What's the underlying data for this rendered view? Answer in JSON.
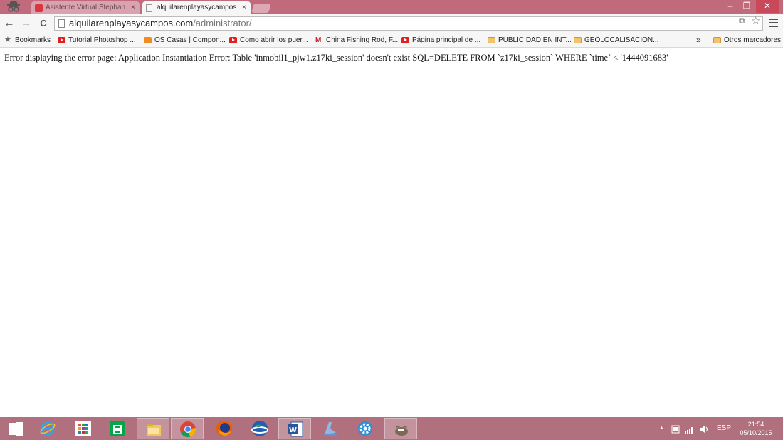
{
  "tabs": [
    {
      "title": "Asistente Virtual Stephan",
      "close": "×"
    },
    {
      "title": "alquilarenplayasycampos",
      "close": "×"
    }
  ],
  "window": {
    "minimize": "–",
    "maximize": "❐",
    "close": "✕"
  },
  "toolbar": {
    "back": "←",
    "forward": "→",
    "reload": "C",
    "translate": "⧉",
    "star": "☆"
  },
  "address": {
    "domain": "alquilarenplayasycampos.com",
    "path": "/administrator/"
  },
  "bookmarks": {
    "items": [
      {
        "label": "Bookmarks",
        "icon": "star-icon"
      },
      {
        "label": "Tutorial Photoshop ...",
        "icon": "youtube-icon"
      },
      {
        "label": "OS Casas | Compon...",
        "icon": "os-icon"
      },
      {
        "label": "Como abrir los puer...",
        "icon": "youtube-icon"
      },
      {
        "label": "China Fishing Rod, F...",
        "icon": "chinafishing-icon"
      },
      {
        "label": "Página principal de ...",
        "icon": "youtube-icon"
      },
      {
        "label": "PUBLICIDAD EN INT...",
        "icon": "folder-icon"
      },
      {
        "label": "GEOLOCALISACION...",
        "icon": "folder-icon"
      }
    ],
    "overflow": "»",
    "other": "Otros marcadores"
  },
  "page": {
    "error_text": "Error displaying the error page: Application Instantiation Error: Table 'inmobil1_pjw1.z17ki_session' doesn't exist SQL=DELETE FROM `z17ki_session` WHERE `time` < '1444091683'"
  },
  "taskbar": {
    "apps": [
      "windows-start",
      "internet-explorer",
      "store-tiles",
      "store",
      "file-explorer",
      "chrome",
      "firefox",
      "google-earth",
      "word",
      "app-blue",
      "app-gear",
      "gimp"
    ],
    "tray": {
      "chevron": "▲",
      "lang": "ESP",
      "time": "21:54",
      "date": "05/10/2015"
    }
  },
  "colors": {
    "titlebar": "#c06a7c",
    "taskbar": "#b0707e",
    "active_tab": "#f6f6f6"
  }
}
